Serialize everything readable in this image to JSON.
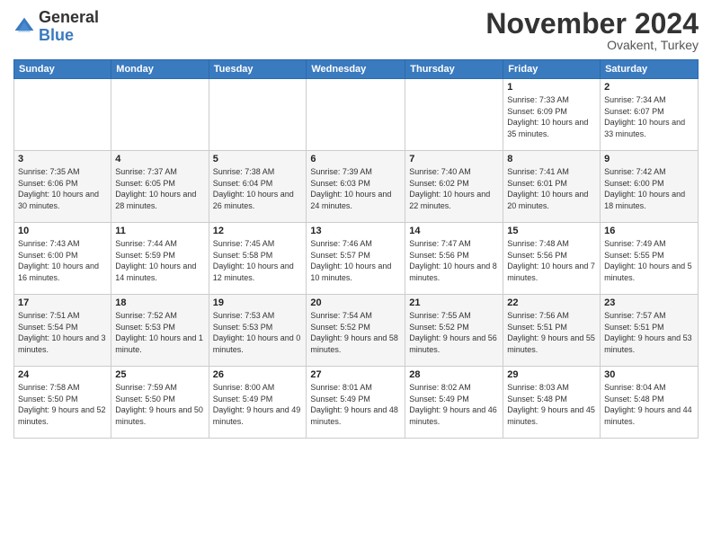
{
  "logo": {
    "general": "General",
    "blue": "Blue"
  },
  "header": {
    "month": "November 2024",
    "location": "Ovakent, Turkey"
  },
  "weekdays": [
    "Sunday",
    "Monday",
    "Tuesday",
    "Wednesday",
    "Thursday",
    "Friday",
    "Saturday"
  ],
  "weeks": [
    [
      {
        "day": "",
        "info": ""
      },
      {
        "day": "",
        "info": ""
      },
      {
        "day": "",
        "info": ""
      },
      {
        "day": "",
        "info": ""
      },
      {
        "day": "",
        "info": ""
      },
      {
        "day": "1",
        "info": "Sunrise: 7:33 AM\nSunset: 6:09 PM\nDaylight: 10 hours and 35 minutes."
      },
      {
        "day": "2",
        "info": "Sunrise: 7:34 AM\nSunset: 6:07 PM\nDaylight: 10 hours and 33 minutes."
      }
    ],
    [
      {
        "day": "3",
        "info": "Sunrise: 7:35 AM\nSunset: 6:06 PM\nDaylight: 10 hours and 30 minutes."
      },
      {
        "day": "4",
        "info": "Sunrise: 7:37 AM\nSunset: 6:05 PM\nDaylight: 10 hours and 28 minutes."
      },
      {
        "day": "5",
        "info": "Sunrise: 7:38 AM\nSunset: 6:04 PM\nDaylight: 10 hours and 26 minutes."
      },
      {
        "day": "6",
        "info": "Sunrise: 7:39 AM\nSunset: 6:03 PM\nDaylight: 10 hours and 24 minutes."
      },
      {
        "day": "7",
        "info": "Sunrise: 7:40 AM\nSunset: 6:02 PM\nDaylight: 10 hours and 22 minutes."
      },
      {
        "day": "8",
        "info": "Sunrise: 7:41 AM\nSunset: 6:01 PM\nDaylight: 10 hours and 20 minutes."
      },
      {
        "day": "9",
        "info": "Sunrise: 7:42 AM\nSunset: 6:00 PM\nDaylight: 10 hours and 18 minutes."
      }
    ],
    [
      {
        "day": "10",
        "info": "Sunrise: 7:43 AM\nSunset: 6:00 PM\nDaylight: 10 hours and 16 minutes."
      },
      {
        "day": "11",
        "info": "Sunrise: 7:44 AM\nSunset: 5:59 PM\nDaylight: 10 hours and 14 minutes."
      },
      {
        "day": "12",
        "info": "Sunrise: 7:45 AM\nSunset: 5:58 PM\nDaylight: 10 hours and 12 minutes."
      },
      {
        "day": "13",
        "info": "Sunrise: 7:46 AM\nSunset: 5:57 PM\nDaylight: 10 hours and 10 minutes."
      },
      {
        "day": "14",
        "info": "Sunrise: 7:47 AM\nSunset: 5:56 PM\nDaylight: 10 hours and 8 minutes."
      },
      {
        "day": "15",
        "info": "Sunrise: 7:48 AM\nSunset: 5:56 PM\nDaylight: 10 hours and 7 minutes."
      },
      {
        "day": "16",
        "info": "Sunrise: 7:49 AM\nSunset: 5:55 PM\nDaylight: 10 hours and 5 minutes."
      }
    ],
    [
      {
        "day": "17",
        "info": "Sunrise: 7:51 AM\nSunset: 5:54 PM\nDaylight: 10 hours and 3 minutes."
      },
      {
        "day": "18",
        "info": "Sunrise: 7:52 AM\nSunset: 5:53 PM\nDaylight: 10 hours and 1 minute."
      },
      {
        "day": "19",
        "info": "Sunrise: 7:53 AM\nSunset: 5:53 PM\nDaylight: 10 hours and 0 minutes."
      },
      {
        "day": "20",
        "info": "Sunrise: 7:54 AM\nSunset: 5:52 PM\nDaylight: 9 hours and 58 minutes."
      },
      {
        "day": "21",
        "info": "Sunrise: 7:55 AM\nSunset: 5:52 PM\nDaylight: 9 hours and 56 minutes."
      },
      {
        "day": "22",
        "info": "Sunrise: 7:56 AM\nSunset: 5:51 PM\nDaylight: 9 hours and 55 minutes."
      },
      {
        "day": "23",
        "info": "Sunrise: 7:57 AM\nSunset: 5:51 PM\nDaylight: 9 hours and 53 minutes."
      }
    ],
    [
      {
        "day": "24",
        "info": "Sunrise: 7:58 AM\nSunset: 5:50 PM\nDaylight: 9 hours and 52 minutes."
      },
      {
        "day": "25",
        "info": "Sunrise: 7:59 AM\nSunset: 5:50 PM\nDaylight: 9 hours and 50 minutes."
      },
      {
        "day": "26",
        "info": "Sunrise: 8:00 AM\nSunset: 5:49 PM\nDaylight: 9 hours and 49 minutes."
      },
      {
        "day": "27",
        "info": "Sunrise: 8:01 AM\nSunset: 5:49 PM\nDaylight: 9 hours and 48 minutes."
      },
      {
        "day": "28",
        "info": "Sunrise: 8:02 AM\nSunset: 5:49 PM\nDaylight: 9 hours and 46 minutes."
      },
      {
        "day": "29",
        "info": "Sunrise: 8:03 AM\nSunset: 5:48 PM\nDaylight: 9 hours and 45 minutes."
      },
      {
        "day": "30",
        "info": "Sunrise: 8:04 AM\nSunset: 5:48 PM\nDaylight: 9 hours and 44 minutes."
      }
    ]
  ]
}
